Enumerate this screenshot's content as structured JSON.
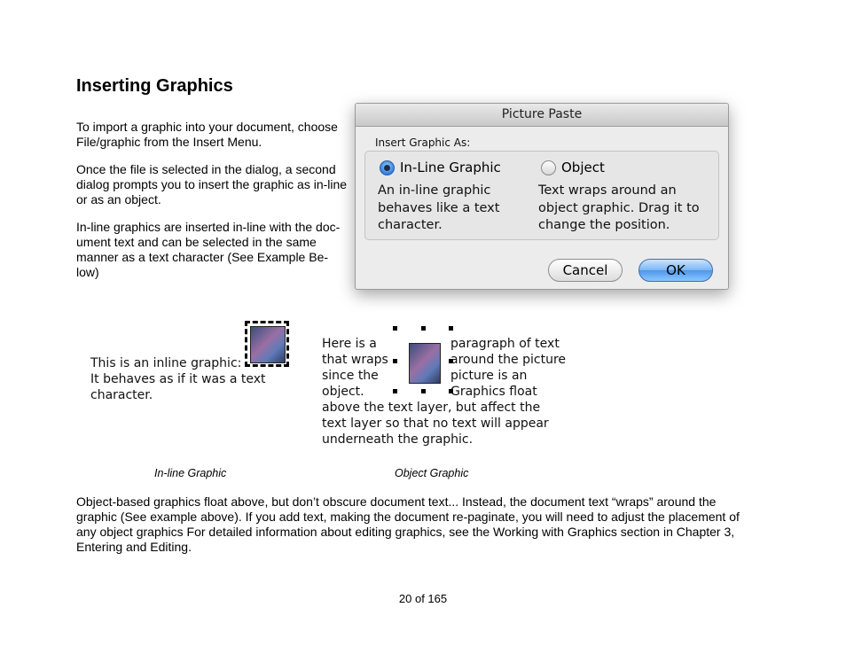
{
  "heading": "Inserting Graphics",
  "paragraphs": {
    "p1": [
      "To import a graphic into your document, choose",
      "File/graphic from the Insert Menu."
    ],
    "p2": [
      "Once the file is selected in the dialog, a second",
      "dialog prompts you to insert the graphic as in-line",
      "or as an object."
    ],
    "p3": [
      "In-line graphics are inserted in-line with the doc-",
      "ument text and can be selected in the same",
      "manner as a text character (See Example Be-",
      "low)"
    ]
  },
  "dialog": {
    "title": "Picture Paste",
    "group_label": "Insert Graphic As:",
    "options": [
      {
        "label": "In-Line Graphic",
        "selected": true,
        "desc": [
          "An in-line graphic",
          "behaves like a text",
          "character."
        ]
      },
      {
        "label": "Object",
        "selected": false,
        "desc": [
          "Text wraps around an",
          "object graphic. Drag it to",
          "change the position."
        ]
      }
    ],
    "cancel_label": "Cancel",
    "ok_label": "OK"
  },
  "inline_example": {
    "lines": [
      "This is an inline graphic:",
      "It behaves as if it was a text",
      "character."
    ],
    "caption": "In-line Graphic"
  },
  "object_example": {
    "left_lines": [
      "Here is a",
      "that wraps",
      "since the",
      "object."
    ],
    "right_lines": [
      "paragraph of text",
      "around the picture",
      "picture is an",
      "Graphics  float"
    ],
    "bottom_lines": [
      "above the text layer, but affect the",
      "text layer so that no text will appear",
      "underneath the graphic."
    ],
    "caption": "Object Graphic"
  },
  "body_paragraph": [
    "Object-based graphics float above, but don’t obscure document text... Instead, the document text “wraps” around the",
    "graphic (See example above). If you add text, making the document re-paginate, you will need to adjust the placement of",
    "any object graphics For detailed information about editing graphics, see the Working with Graphics section in Chapter 3,",
    "Entering and Editing."
  ],
  "page_number": "20 of 165"
}
